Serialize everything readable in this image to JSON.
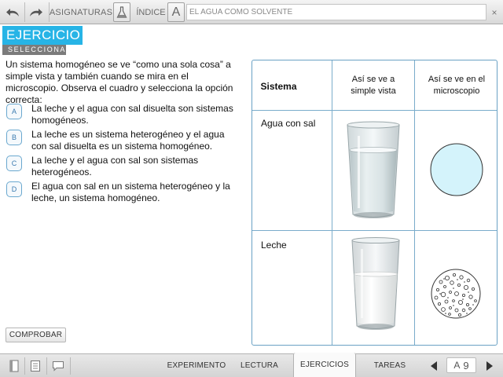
{
  "toolbar": {
    "undo_icon": "undo-arrow-icon",
    "redo_icon": "redo-arrow-icon",
    "asignaturas_label": "ASIGNATURAS",
    "flask_icon": "flask-icon",
    "indice_label": "ÍNDICE",
    "a_label": "A",
    "path_title": "EL AGUA COMO SOLVENTE",
    "close_label": "×"
  },
  "header": {
    "title": "EJERCICIO",
    "subtitle": "SELECCIONA"
  },
  "question": {
    "text": "Un sistema homogéneo se ve “como una sola cosa” a simple vista y también cuando se mira en el microscopio. Observa el cuadro y selecciona la opción correcta:"
  },
  "options": [
    {
      "letter": "A",
      "text": "La leche y el agua con sal disuelta son sistemas homogéneos."
    },
    {
      "letter": "B",
      "text": "La leche es un sistema heterogéneo y el agua con sal disuelta es un sistema homogéneo."
    },
    {
      "letter": "C",
      "text": "La leche y el agua con sal son sistemas heterogéneos."
    },
    {
      "letter": "D",
      "text": "El agua con sal en un sistema heterogéneo y la leche, un sistema homogéneo."
    }
  ],
  "check_button": "COMPROBAR",
  "table": {
    "headers": [
      "Sistema",
      "Así se ve a simple vista",
      "Así se ve en el microscopio"
    ],
    "rows": [
      {
        "label": "Agua con sal"
      },
      {
        "label": "Leche"
      }
    ],
    "colors": {
      "border": "#6aa1c4",
      "water_circle_fill": "#d4f3fb"
    }
  },
  "bottombar": {
    "tabs": [
      "EXPERIMENTO",
      "LECTURA",
      "EJERCICIOS",
      "TAREAS"
    ],
    "active_tab": "EJERCICIOS",
    "page_letter": "A",
    "page_number": "9"
  },
  "colors": {
    "accent": "#27b4e6",
    "subtitle_bg": "#7b7b7b"
  }
}
